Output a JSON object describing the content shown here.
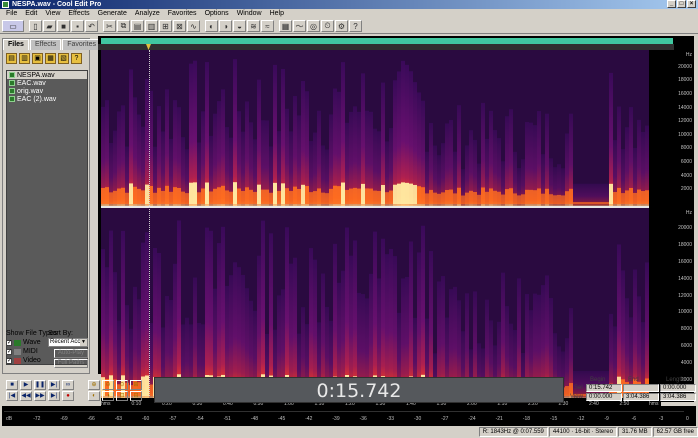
{
  "window": {
    "title": "NESPA.wav - Cool Edit Pro"
  },
  "menu": [
    "File",
    "Edit",
    "View",
    "Effects",
    "Generate",
    "Analyze",
    "Favorites",
    "Options",
    "Window",
    "Help"
  ],
  "panel": {
    "tabs": [
      "Files",
      "Effects",
      "Favorites"
    ],
    "files": [
      "NESPA.wav",
      "EAC.wav",
      "orig.wav",
      "EAC (2).wav"
    ],
    "show_types_label": "Show File Types",
    "sort_label": "Sort By:",
    "types": [
      "Wave",
      "MIDI",
      "Video"
    ],
    "sort_value": "Recent Acc",
    "auto_play": "Auto-Play",
    "full_paths": "Full Paths"
  },
  "hz_labels": [
    "Hz",
    "20000",
    "18000",
    "16000",
    "14000",
    "12000",
    "10000",
    "8000",
    "6000",
    "4000",
    "2000",
    "Hz",
    "20000",
    "18000",
    "16000",
    "14000",
    "12000",
    "10000",
    "8000",
    "6000",
    "4000",
    "2000"
  ],
  "time_labels": [
    "hms",
    "0:10",
    "0:20",
    "0:30",
    "0:40",
    "0:50",
    "1:00",
    "1:10",
    "1:20",
    "1:30",
    "1:40",
    "1:50",
    "2:00",
    "2:10",
    "2:20",
    "2:30",
    "2:40",
    "2:50",
    "hms"
  ],
  "time_display": "0:15.742",
  "selection": {
    "headers": [
      "Begin",
      "End",
      "Length"
    ],
    "sel_label": "Sel",
    "view_label": "View",
    "sel": [
      "0:15.742",
      "",
      "0:00.000"
    ],
    "view": [
      "0:00.000",
      "3:04.386",
      "3:04.386"
    ]
  },
  "meter_scale": [
    "dB",
    "-72",
    "-69",
    "-66",
    "-63",
    "-60",
    "-57",
    "-54",
    "-51",
    "-48",
    "-45",
    "-42",
    "-39",
    "-36",
    "-33",
    "-30",
    "-27",
    "-24",
    "-21",
    "-18",
    "-15",
    "-12",
    "-9",
    "-6",
    "-3",
    "0"
  ],
  "status": [
    "R: 1843Hz @ 0:07.559",
    "44100 · 16-bit · Stereo",
    "31.76 MB",
    "62.57 GB free"
  ]
}
